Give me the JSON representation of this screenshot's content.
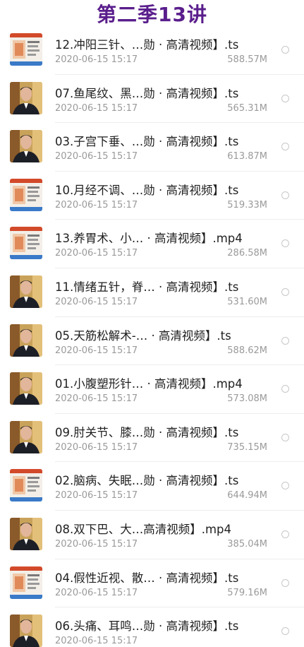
{
  "header": {
    "title": "第二季13讲"
  },
  "files": [
    {
      "name": "12.冲阳三针、…勋 · 高清视频】.ts",
      "date": "2020-06-15 15:17",
      "size": "588.57M",
      "thumb": "slide"
    },
    {
      "name": "07.鱼尾纹、黑…勋 · 高清视频】.ts",
      "date": "2020-06-15 15:17",
      "size": "565.31M",
      "thumb": "person"
    },
    {
      "name": "03.子宫下垂、…勋 · 高清视频】.ts",
      "date": "2020-06-15 15:17",
      "size": "613.87M",
      "thumb": "person"
    },
    {
      "name": "10.月经不调、…勋 · 高清视频】.ts",
      "date": "2020-06-15 15:17",
      "size": "519.33M",
      "thumb": "slide"
    },
    {
      "name": "13.养胃术、小… · 高清视频】.mp4",
      "date": "2020-06-15 15:17",
      "size": "286.58M",
      "thumb": "slide"
    },
    {
      "name": "11.情绪五针，脊… · 高清视频】.ts",
      "date": "2020-06-15 15:17",
      "size": "531.60M",
      "thumb": "person"
    },
    {
      "name": "05.天筋松解术-… · 高清视频】.ts",
      "date": "2020-06-15 15:17",
      "size": "588.62M",
      "thumb": "person"
    },
    {
      "name": "01.小腹塑形针… · 高清视频】.mp4",
      "date": "2020-06-15 15:17",
      "size": "573.08M",
      "thumb": "person"
    },
    {
      "name": "09.肘关节、膝…勋 · 高清视频】.ts",
      "date": "2020-06-15 15:17",
      "size": "735.15M",
      "thumb": "person"
    },
    {
      "name": "02.脑病、失眠…勋 · 高清视频】.ts",
      "date": "2020-06-15 15:17",
      "size": "644.94M",
      "thumb": "slide"
    },
    {
      "name": "08.双下巴、大…高清视频】.mp4",
      "date": "2020-06-15 15:17",
      "size": "385.04M",
      "thumb": "person"
    },
    {
      "name": "04.假性近视、散… · 高清视频】.ts",
      "date": "2020-06-15 15:17",
      "size": "579.16M",
      "thumb": "slide"
    },
    {
      "name": "06.头痛、耳鸣…勋 · 高清视频】.ts",
      "date": "2020-06-15 15:17",
      "size": "",
      "thumb": "person"
    }
  ],
  "colors": {
    "title": "#5a1e8c",
    "text": "#1f1f1f",
    "meta": "#9a9a9a"
  }
}
